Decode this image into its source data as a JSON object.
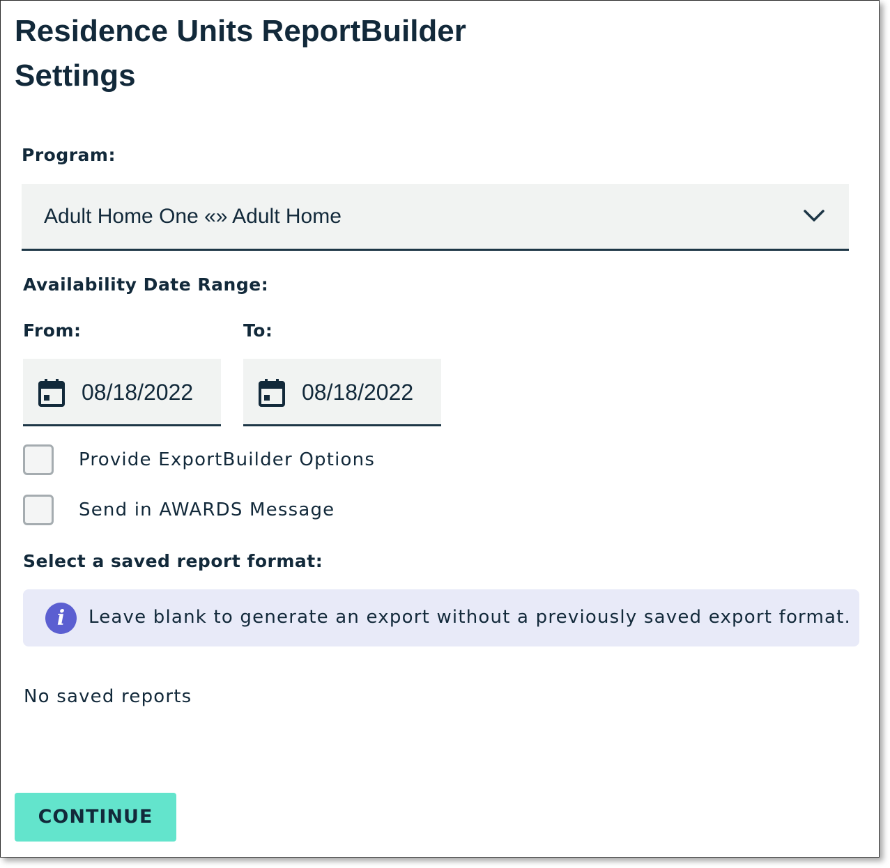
{
  "page": {
    "title": "Residence Units ReportBuilder Settings"
  },
  "program": {
    "label": "Program:",
    "selected": "Adult Home One «» Adult Home",
    "icon": "chevron-down-icon"
  },
  "date_range": {
    "label": "Availability Date Range:",
    "from": {
      "label": "From:",
      "value": "08/18/2022",
      "icon": "calendar-icon"
    },
    "to": {
      "label": "To:",
      "value": "08/18/2022",
      "icon": "calendar-icon"
    }
  },
  "options": {
    "export_builder": {
      "label": "Provide ExportBuilder Options",
      "checked": false
    },
    "awards_message": {
      "label": "Send in AWARDS Message",
      "checked": false
    }
  },
  "saved_format": {
    "label": "Select a saved report format:",
    "info_icon": "info-icon",
    "info_text": "Leave blank to generate an export without a previously saved export format.",
    "empty_text": "No saved reports"
  },
  "actions": {
    "continue_label": "CONTINUE"
  },
  "colors": {
    "primary_text": "#12293a",
    "field_bg": "#f1f3f2",
    "info_bg": "#e8eaf8",
    "info_icon": "#5b5fd1",
    "button": "#63e4cc"
  }
}
